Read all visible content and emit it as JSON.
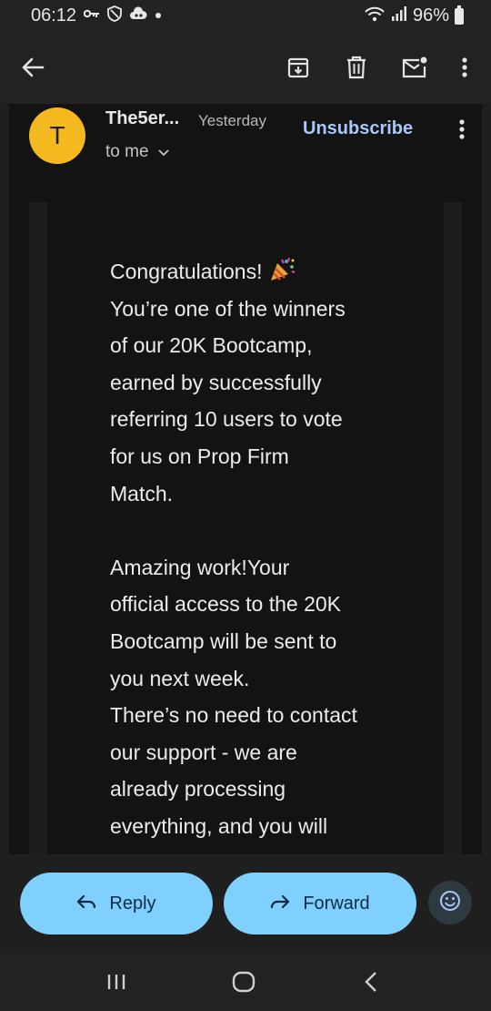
{
  "status_bar": {
    "time": "06:12",
    "battery": "96%",
    "icons": [
      "key-icon",
      "shield-icon",
      "cloud-icon",
      "dot-icon",
      "wifi-icon",
      "signal-icon",
      "battery-icon"
    ]
  },
  "toolbar": {
    "icons": [
      "back-arrow-icon",
      "archive-icon",
      "delete-icon",
      "mark-unread-icon",
      "more-vert-icon"
    ]
  },
  "email": {
    "avatar_letter": "T",
    "sender": "The5er...",
    "date": "Yesterday",
    "recipient": "to me",
    "unsubscribe": "Unsubscribe",
    "paragraphs": [
      "Congratulations!",
      "You’re one of the winners\nof our 20K Bootcamp,\nearned by successfully\nreferring 10 users to vote\nfor us on Prop Firm\nMatch.",
      "Amazing work!Your\nofficial access to the 20K\nBootcamp will be sent to\nyou next week.\nThere’s no need to contact\nour support - we are\nalready processing\neverything, and you will"
    ]
  },
  "actions": {
    "reply": "Reply",
    "forward": "Forward"
  },
  "colors": {
    "avatar": "#f5b920",
    "accent_link": "#a8c7fa",
    "pill": "#7fcfff"
  }
}
